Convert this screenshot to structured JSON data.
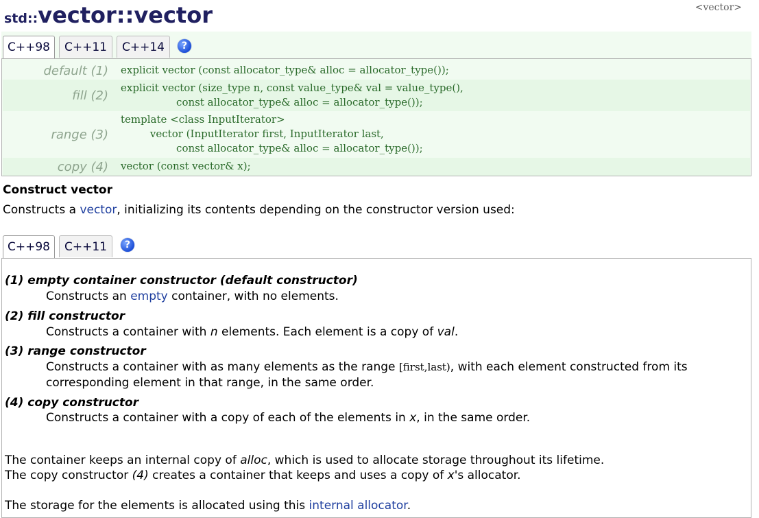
{
  "header": {
    "namespace": "std::",
    "class_name": "vector",
    "separator": "::",
    "function_name": "vector",
    "header_ref": "<vector>"
  },
  "proto_tabs": [
    "C++98",
    "C++11",
    "C++14"
  ],
  "help_label": "?",
  "prototypes": [
    {
      "label": "default (1)",
      "code": "explicit vector (const allocator_type& alloc = allocator_type());"
    },
    {
      "label": "fill (2)",
      "code": "explicit vector (size_type n, const value_type& val = value_type(),\n                 const allocator_type& alloc = allocator_type());"
    },
    {
      "label": "range (3)",
      "code": "template <class InputIterator>\n         vector (InputIterator first, InputIterator last,\n                 const allocator_type& alloc = allocator_type());"
    },
    {
      "label": "copy (4)",
      "code": "vector (const vector& x);"
    }
  ],
  "section": {
    "title": "Construct vector",
    "intro_before": "Constructs a ",
    "intro_link": "vector",
    "intro_after": ", initializing its contents depending on the constructor version used:"
  },
  "desc_tabs": [
    "C++98",
    "C++11"
  ],
  "details": {
    "empty_title": "(1) empty container constructor (default constructor)",
    "empty_before": "Constructs an ",
    "empty_link": "empty",
    "empty_after": " container, with no elements.",
    "fill_title": "(2) fill constructor",
    "fill_before": "Constructs a container with ",
    "fill_n": "n",
    "fill_mid": " elements. Each element is a copy of ",
    "fill_val": "val",
    "fill_end": ".",
    "range_title": "(3) range constructor",
    "range_before": "Constructs a container with as many elements as the range ",
    "range_code": "[first,last)",
    "range_after": ", with each element constructed from its",
    "range_line2": "corresponding element in that range, in the same order.",
    "copy_title": "(4) copy constructor",
    "copy_before": "Constructs a container with a copy of each of the elements in ",
    "copy_x": "x",
    "copy_after": ", in the same order.",
    "alloc_before": "The container keeps an internal copy of ",
    "alloc_word": "alloc",
    "alloc_after": ", which is used to allocate storage throughout its lifetime.",
    "copyalloc_before": "The copy constructor ",
    "copyalloc_num": "(4)",
    "copyalloc_mid": " creates a container that keeps and uses a copy of ",
    "copyalloc_x": "x",
    "copyalloc_after": "'s allocator.",
    "storage_before": "The storage for the elements is allocated using this ",
    "storage_link": "internal allocator",
    "storage_after": "."
  }
}
